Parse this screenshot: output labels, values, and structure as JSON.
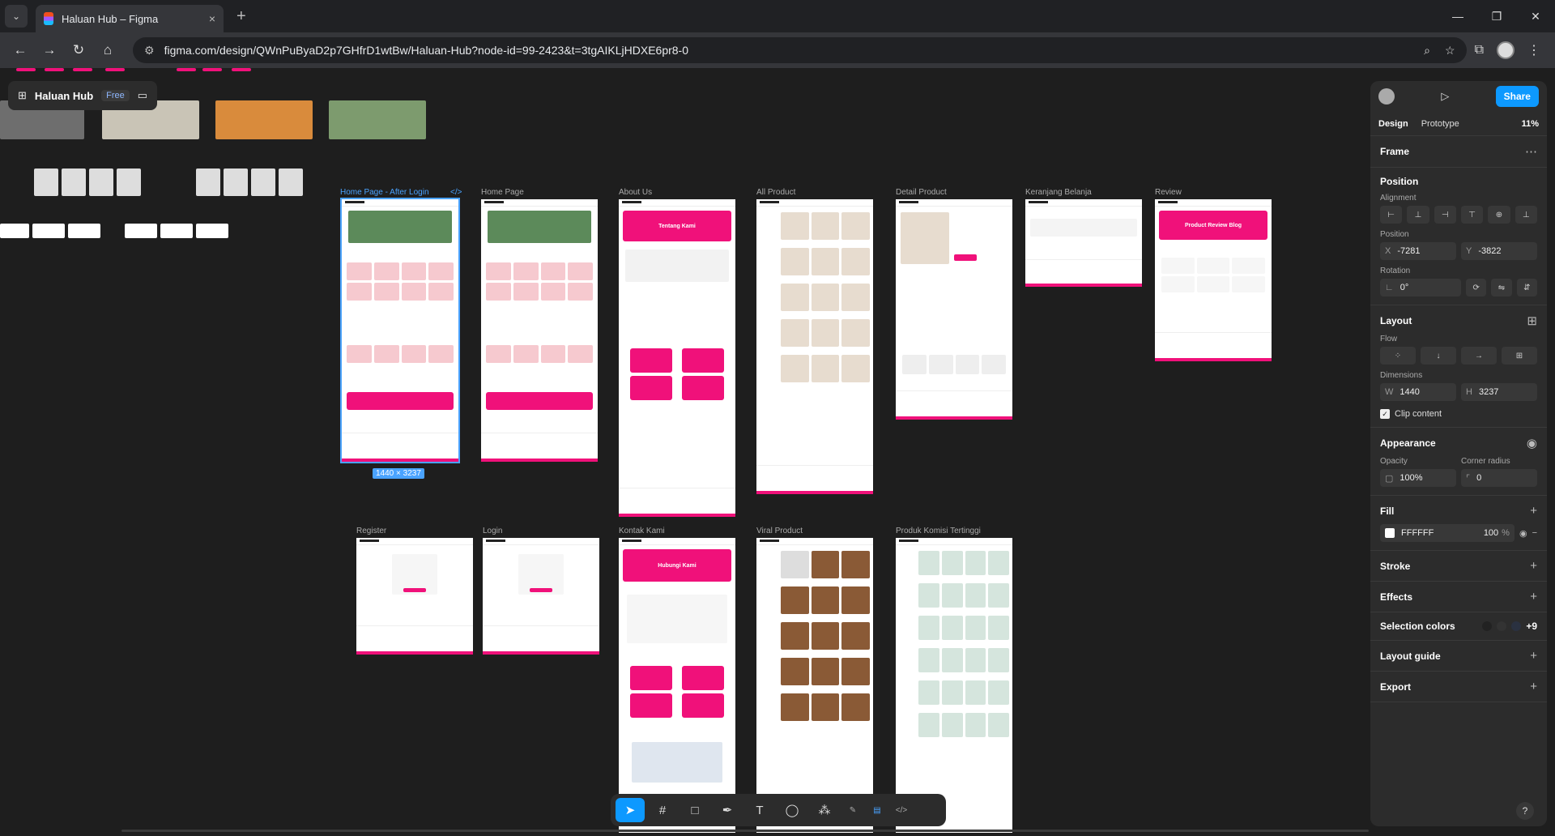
{
  "browser": {
    "tab_title": "Haluan Hub – Figma",
    "url": "figma.com/design/QWnPuByaD2p7GHfrD1wtBw/Haluan-Hub?node-id=99-2423&t=3tgAIKLjHDXE6pr8-0",
    "new_tab_icon": "+",
    "close_tab_icon": "×"
  },
  "file": {
    "name": "Haluan Hub",
    "plan": "Free"
  },
  "frames": {
    "home_after_login": "Home Page - After Login",
    "home": "Home Page",
    "about": "About Us",
    "all_product": "All Product",
    "detail_product": "Detail Product",
    "keranjang": "Keranjang Belanja",
    "review": "Review",
    "register": "Register",
    "login": "Login",
    "kontak": "Kontak Kami",
    "viral": "Viral Product",
    "komisi": "Produk Komisi Tertinggi"
  },
  "frame_texts": {
    "tentang_kami": "Tentang Kami",
    "hubungi_kami": "Hubungi Kami",
    "product_review_blog": "Product Review Blog"
  },
  "selection_size": "1440 × 3237",
  "panel": {
    "share": "Share",
    "tabs": {
      "design": "Design",
      "prototype": "Prototype",
      "zoom": "11%"
    },
    "frame_label": "Frame",
    "position": {
      "title": "Position",
      "alignment": "Alignment",
      "position_label": "Position",
      "x_label": "X",
      "x": "-7281",
      "y_label": "Y",
      "y": "-3822",
      "rotation_label": "Rotation",
      "rotation": "0°"
    },
    "layout": {
      "title": "Layout",
      "flow": "Flow",
      "dimensions": "Dimensions",
      "w_label": "W",
      "w": "1440",
      "h_label": "H",
      "h": "3237",
      "clip": "Clip content"
    },
    "appearance": {
      "title": "Appearance",
      "opacity_label": "Opacity",
      "opacity": "100%",
      "radius_label": "Corner radius",
      "radius": "0"
    },
    "fill": {
      "title": "Fill",
      "hex": "FFFFFF",
      "opacity": "100",
      "pct": "%"
    },
    "stroke": "Stroke",
    "effects": "Effects",
    "selection_colors": {
      "title": "Selection colors",
      "more": "+9"
    },
    "layout_guide": "Layout guide",
    "export": "Export"
  },
  "colors": {
    "accent": "#0d99ff",
    "brand_pink": "#f0117a",
    "panel_bg": "#2c2c2c",
    "canvas_bg": "#1e1e1e"
  }
}
